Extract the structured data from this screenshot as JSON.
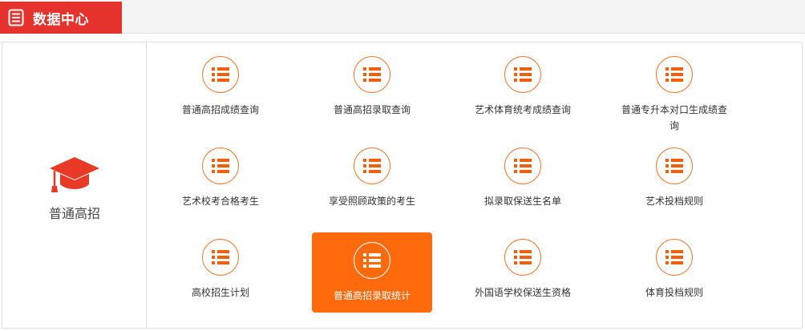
{
  "header": {
    "title": "数据中心",
    "icon": "document-icon"
  },
  "category": {
    "label": "普通高招",
    "icon": "graduation-cap-icon"
  },
  "colors": {
    "accent": "#ff6a0c",
    "header_red": "#e5322d",
    "icon_orange": "#ef5f0c"
  },
  "items": [
    {
      "label": "普通高招成绩查询"
    },
    {
      "label": "普通高招录取查询"
    },
    {
      "label": "艺术体育统考成绩查询"
    },
    {
      "label": "普通专升本对口生成绩查询"
    },
    {
      "label": "艺术校考合格考生"
    },
    {
      "label": "享受照顾政策的考生"
    },
    {
      "label": "拟录取保送生名单"
    },
    {
      "label": "艺术投档规则"
    },
    {
      "label": "高校招生计划"
    },
    {
      "label": "普通高招录取统计",
      "active": true
    },
    {
      "label": "外国语学校保送生资格"
    },
    {
      "label": "体育投档规则"
    }
  ]
}
